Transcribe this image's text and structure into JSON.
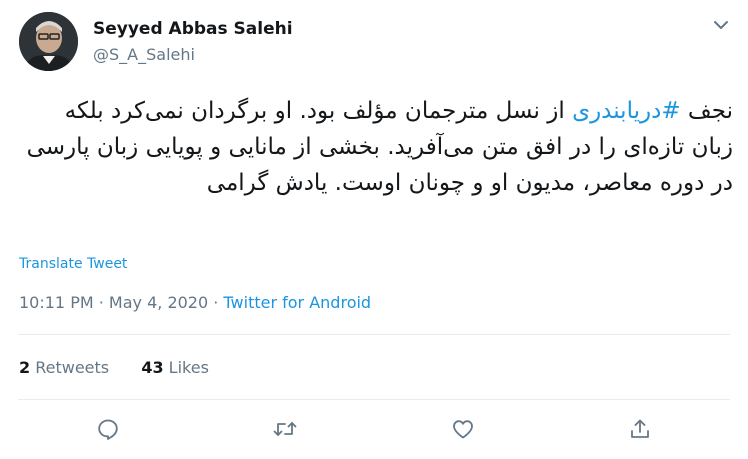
{
  "author": {
    "name": "Seyyed Abbas Salehi",
    "handle": "@S_A_Salehi"
  },
  "tweet": {
    "before_hashtag": "نجف ",
    "hashtag": "#دریابندری",
    "after_hashtag": " از نسل مترجمان مؤلف بود. او برگردان نمی‌کرد بلکه زبان تازه‌ای را در افق متن می‌آفرید. بخشی از مانایی و پویایی زبان پارسی در دوره معاصر، مدیون او و چونان اوست.   یادش گرامی"
  },
  "translate_label": "Translate Tweet",
  "meta": {
    "time": "10:11 PM",
    "separator": " · ",
    "date": "May 4, 2020",
    "source": "Twitter for Android"
  },
  "stats": {
    "retweets_count": "2",
    "retweets_label": " Retweets",
    "likes_count": "43",
    "likes_label": " Likes"
  },
  "icons": {
    "caret": "chevron-down-icon",
    "reply": "reply-icon",
    "retweet": "retweet-icon",
    "like": "heart-icon",
    "share": "share-icon"
  },
  "colors": {
    "link": "#1b95e0",
    "muted": "#657786",
    "text": "#14171a",
    "divider": "#e6ecf0"
  }
}
